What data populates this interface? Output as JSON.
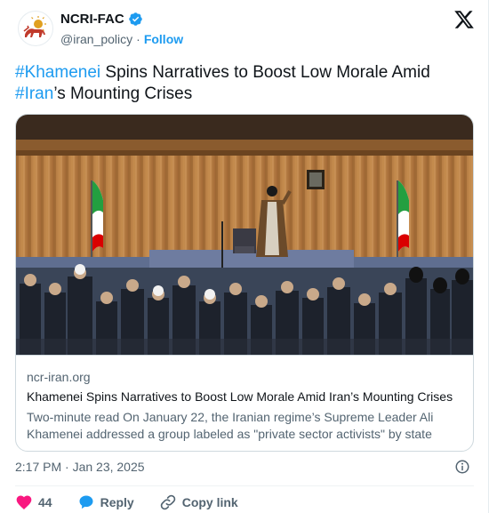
{
  "author": {
    "display_name": "NCRI-FAC",
    "handle": "@iran_policy",
    "separator": "·",
    "follow_label": "Follow",
    "verified_color": "#1d9bf0",
    "avatar_icon": "lion-and-sun-emblem"
  },
  "tweet": {
    "hashtag_1": "#Khamenei",
    "text_1": " Spins Narratives to Boost Low Morale Amid ",
    "hashtag_2": "#Iran",
    "text_2": "’s Mounting Crises"
  },
  "link_card": {
    "domain": "ncr-iran.org",
    "title": "Khamenei Spins Narratives to Boost Low Morale Amid Iran’s Mounting Crises",
    "description": "Two-minute read On January 22, the Iranian regime’s Supreme Leader Ali Khamenei addressed a group labeled as \"private sector activists\" by state media.",
    "image_alt": "photo-of-audience-hall"
  },
  "meta": {
    "timestamp": "2:17 PM · Jan 23, 2025"
  },
  "actions": {
    "like_count": "44",
    "reply_label": "Reply",
    "copy_link_label": "Copy link"
  },
  "colors": {
    "accent": "#1d9bf0",
    "like": "#f91880",
    "muted": "#536471"
  }
}
